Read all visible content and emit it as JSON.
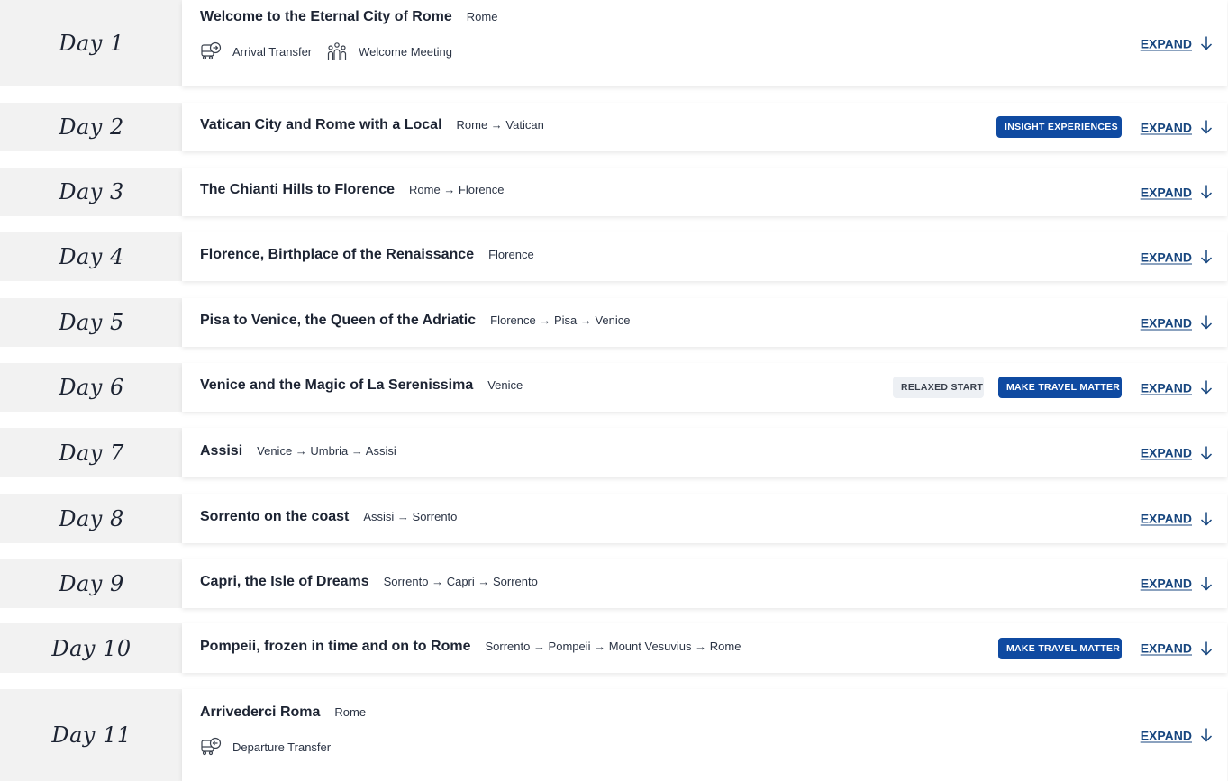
{
  "itinerary": {
    "expand_label": "EXPAND",
    "accent_color": "#0f4aa1",
    "days": [
      {
        "day": "Day 1",
        "title": "Welcome to the Eternal City of Rome",
        "route": "Rome",
        "highlights": [
          {
            "icon": "arrival-transfer-icon",
            "label": "Arrival Transfer"
          },
          {
            "icon": "welcome-meeting-icon",
            "label": "Welcome Meeting"
          }
        ],
        "badges": []
      },
      {
        "day": "Day 2",
        "title": "Vatican City and Rome with a Local",
        "route": "Rome → Vatican",
        "highlights": [],
        "badges": [
          {
            "label": "INSIGHT EXPERIENCES",
            "style": "blue"
          }
        ]
      },
      {
        "day": "Day 3",
        "title": "The Chianti Hills to Florence",
        "route": "Rome → Florence",
        "highlights": [],
        "badges": []
      },
      {
        "day": "Day 4",
        "title": "Florence, Birthplace of the Renaissance",
        "route": "Florence",
        "highlights": [],
        "badges": []
      },
      {
        "day": "Day 5",
        "title": "Pisa to Venice, the Queen of the Adriatic",
        "route": "Florence → Pisa → Venice",
        "highlights": [],
        "badges": []
      },
      {
        "day": "Day 6",
        "title": "Venice and the Magic of La Serenissima",
        "route": "Venice",
        "highlights": [],
        "badges": [
          {
            "label": "RELAXED START",
            "style": "grey"
          },
          {
            "label": "MAKE TRAVEL MATTER",
            "style": "blue"
          }
        ]
      },
      {
        "day": "Day 7",
        "title": "Assisi",
        "route": "Venice → Umbria → Assisi",
        "highlights": [],
        "badges": []
      },
      {
        "day": "Day 8",
        "title": "Sorrento on the coast",
        "route": "Assisi → Sorrento",
        "highlights": [],
        "badges": []
      },
      {
        "day": "Day 9",
        "title": "Capri, the Isle of Dreams",
        "route": "Sorrento → Capri → Sorrento",
        "highlights": [],
        "badges": []
      },
      {
        "day": "Day 10",
        "title": "Pompeii, frozen in time and on to Rome",
        "route": "Sorrento → Pompeii → Mount Vesuvius → Rome",
        "highlights": [],
        "badges": [
          {
            "label": "MAKE TRAVEL MATTER",
            "style": "blue"
          }
        ]
      },
      {
        "day": "Day 11",
        "title": "Arrivederci Roma",
        "route": "Rome",
        "highlights": [
          {
            "icon": "departure-transfer-icon",
            "label": "Departure Transfer"
          }
        ],
        "badges": []
      }
    ]
  }
}
